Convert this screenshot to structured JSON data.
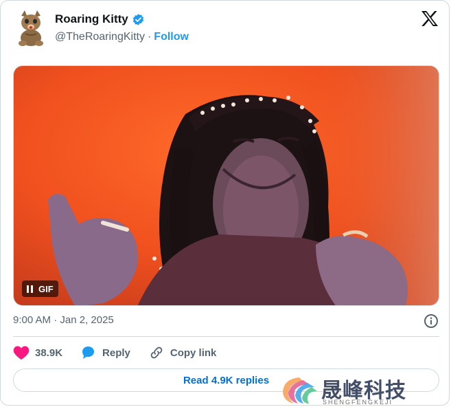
{
  "author": {
    "display_name": "Roaring Kitty",
    "handle": "@TheRoaringKitty",
    "separator": "·",
    "follow_label": "Follow",
    "verified": true
  },
  "media": {
    "badge_label": "GIF",
    "state": "playing"
  },
  "meta": {
    "timestamp": "9:00 AM · Jan 2, 2025"
  },
  "actions": {
    "likes": "38.9K",
    "reply_label": "Reply",
    "copy_link_label": "Copy link"
  },
  "replies_button": {
    "label": "Read 4.9K replies"
  },
  "watermark": {
    "chinese": "晟峰科技",
    "english": "SHENGFENGKEJI"
  },
  "colors": {
    "accent": "#1d9bf0",
    "link": "#006fd6",
    "like": "#f91880",
    "muted": "#536471",
    "border": "#cfd9de"
  }
}
